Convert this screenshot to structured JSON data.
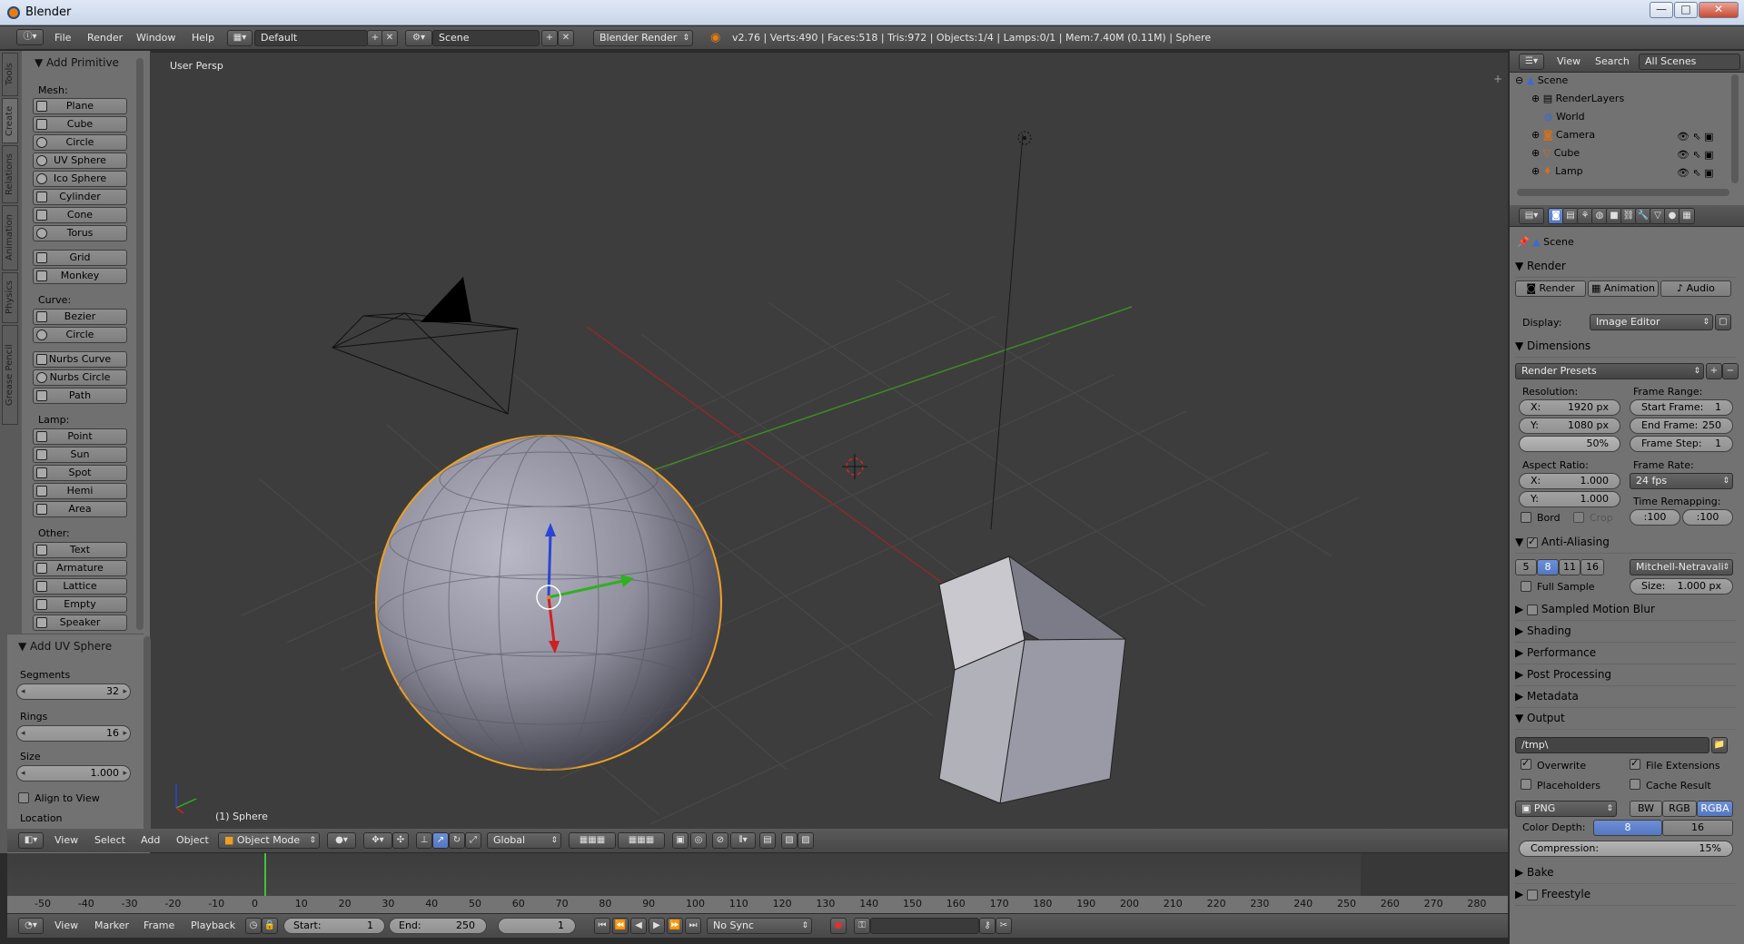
{
  "window": {
    "title": "Blender",
    "minimize": "—",
    "maximize": "□",
    "close": "✕"
  },
  "infobar": {
    "menus": [
      "File",
      "Render",
      "Window",
      "Help"
    ],
    "layout": "Default",
    "scene": "Scene",
    "engine": "Blender Render",
    "stats": "v2.76 | Verts:490 | Faces:518 | Tris:972 | Objects:1/4 | Lamps:0/1 | Mem:7.40M (0.11M) | Sphere"
  },
  "tool_tabs": [
    "Tools",
    "Create",
    "Relations",
    "Animation",
    "Physics",
    "Grease Pencil"
  ],
  "tools": {
    "header": "Add Primitive",
    "groups": [
      {
        "label": "Mesh:",
        "items": [
          "Plane",
          "Cube",
          "Circle",
          "UV Sphere",
          "Ico Sphere",
          "Cylinder",
          "Cone",
          "Torus"
        ]
      },
      {
        "label": "",
        "items": [
          "Grid",
          "Monkey"
        ]
      },
      {
        "label": "Curve:",
        "items": [
          "Bezier",
          "Circle"
        ]
      },
      {
        "label": "",
        "items": [
          "Nurbs Curve",
          "Nurbs Circle",
          "Path"
        ]
      },
      {
        "label": "Lamp:",
        "items": [
          "Point",
          "Sun",
          "Spot",
          "Hemi",
          "Area"
        ]
      },
      {
        "label": "Other:",
        "items": [
          "Text",
          "Armature",
          "Lattice",
          "Empty",
          "Speaker"
        ]
      }
    ]
  },
  "operator": {
    "header": "Add UV Sphere",
    "segments_label": "Segments",
    "segments": "32",
    "rings_label": "Rings",
    "rings": "16",
    "size_label": "Size",
    "size": "1.000",
    "align": "Align to View",
    "location": "Location"
  },
  "viewport": {
    "view_name": "User Persp",
    "object_label": "(1) Sphere"
  },
  "view3d_header": {
    "menus": [
      "View",
      "Select",
      "Add",
      "Object"
    ],
    "mode": "Object Mode",
    "orientation": "Global"
  },
  "timeline": {
    "ticks": [
      "-50",
      "-40",
      "-30",
      "-20",
      "-10",
      "0",
      "10",
      "20",
      "30",
      "40",
      "50",
      "60",
      "70",
      "80",
      "90",
      "100",
      "110",
      "120",
      "130",
      "140",
      "150",
      "160",
      "170",
      "180",
      "190",
      "200",
      "210",
      "220",
      "230",
      "240",
      "250",
      "260",
      "270",
      "280"
    ],
    "menus": [
      "View",
      "Marker",
      "Frame",
      "Playback"
    ],
    "start_label": "Start:",
    "start": "1",
    "end_label": "End:",
    "end": "250",
    "current": "1",
    "sync": "No Sync"
  },
  "outliner": {
    "menus": [
      "View",
      "Search"
    ],
    "filter": "All Scenes",
    "items": [
      "Scene",
      "RenderLayers",
      "World",
      "Camera",
      "Cube",
      "Lamp"
    ]
  },
  "properties": {
    "context": "Scene",
    "render": {
      "header": "Render",
      "buttons": [
        "Render",
        "Animation",
        "Audio"
      ],
      "display_label": "Display:",
      "display": "Image Editor"
    },
    "dimensions": {
      "header": "Dimensions",
      "presets": "Render Presets",
      "resolution_label": "Resolution:",
      "x": "X:",
      "res_x": "1920 px",
      "y": "Y:",
      "res_y": "1080 px",
      "pct": "50%",
      "frame_range_label": "Frame Range:",
      "start": "Start Frame:",
      "start_v": "1",
      "end": "End Frame:",
      "end_v": "250",
      "step": "Frame Step:",
      "step_v": "1",
      "aspect_label": "Aspect Ratio:",
      "ax": "1.000",
      "ay": "1.000",
      "frame_rate_label": "Frame Rate:",
      "fps": "24 fps",
      "remap_label": "Time Remapping:",
      "remap_old": ":100",
      "remap_new": ":100",
      "bord": "Bord",
      "crop": "Crop"
    },
    "aa": {
      "header": "Anti-Aliasing",
      "samples": [
        "5",
        "8",
        "11",
        "16"
      ],
      "filter": "Mitchell-Netravali",
      "full": "Full Sample",
      "size": "Size:",
      "size_v": "1.000 px"
    },
    "collapsed": [
      "Sampled Motion Blur",
      "Shading",
      "Performance",
      "Post Processing",
      "Metadata"
    ],
    "output": {
      "header": "Output",
      "path": "/tmp\\",
      "overwrite": "Overwrite",
      "ext": "File Extensions",
      "placeholders": "Placeholders",
      "cache": "Cache Result",
      "format": "PNG",
      "modes": [
        "BW",
        "RGB",
        "RGBA"
      ],
      "depth_label": "Color Depth:",
      "depths": [
        "8",
        "16"
      ],
      "compression": "Compression:",
      "compression_v": "15%"
    },
    "bake": "Bake",
    "freestyle": "Freestyle"
  },
  "colors": {
    "select_orange": "#f0a020",
    "grid": "#474747",
    "x_axis": "#a02828",
    "y_axis": "#4c9a2a",
    "accent_blue": "#5680c2"
  }
}
